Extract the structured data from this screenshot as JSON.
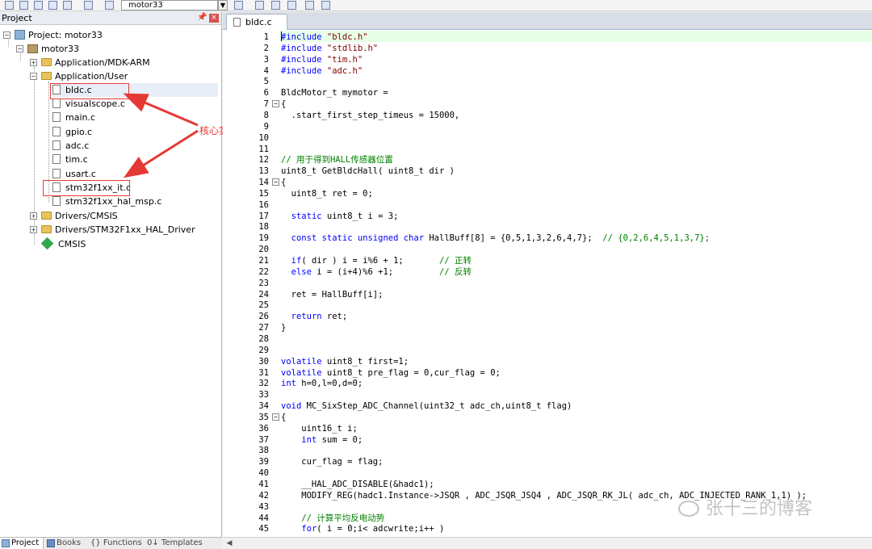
{
  "toolbar": {
    "target_name": "motor33"
  },
  "project_pane": {
    "title": "Project",
    "pin_glyph": "ᵖ",
    "close_glyph": "×",
    "tree": {
      "project_label": "Project: motor33",
      "target_label": "motor33",
      "groups": [
        {
          "label": "Application/MDK-ARM",
          "expanded": false
        },
        {
          "label": "Application/User",
          "expanded": true
        }
      ],
      "files": [
        "bldc.c",
        "visualscope.c",
        "main.c",
        "gpio.c",
        "adc.c",
        "tim.c",
        "usart.c",
        "stm32f1xx_it.c",
        "stm32f1xx_hal_msp.c"
      ],
      "lower_groups": [
        "Drivers/CMSIS",
        "Drivers/STM32F1xx_HAL_Driver"
      ],
      "cmsis_label": "CMSIS"
    },
    "tabs": [
      "Project",
      "Books",
      "{} Functions",
      "0↓ Templates"
    ]
  },
  "annotation": {
    "text": "核心实现在这两个文件中",
    "color": "#e53935"
  },
  "editor": {
    "tab_label": "bldc.c",
    "lines": [
      {
        "n": "1",
        "html": "<span class=\"kw\">#include</span> <span class=\"str\">\"bldc.h\"</span>"
      },
      {
        "n": "2",
        "html": "<span class=\"kw\">#include</span> <span class=\"str\">\"stdlib.h\"</span>"
      },
      {
        "n": "3",
        "html": "<span class=\"kw\">#include</span> <span class=\"str\">\"tim.h\"</span>"
      },
      {
        "n": "4",
        "html": "<span class=\"kw\">#include</span> <span class=\"str\">\"adc.h\"</span>"
      },
      {
        "n": "5",
        "html": ""
      },
      {
        "n": "6",
        "html": "BldcMotor_t mymotor ="
      },
      {
        "n": "7",
        "html": "{",
        "fold": true
      },
      {
        "n": "8",
        "html": "  .start_first_step_timeus = 15000,"
      },
      {
        "n": "9",
        "html": ""
      },
      {
        "n": "10",
        "html": ""
      },
      {
        "n": "11",
        "html": ""
      },
      {
        "n": "12",
        "html": "<span class=\"cmt\">// 用于得到HALL传感器位置</span>"
      },
      {
        "n": "13",
        "html": "uint8_t GetBldcHall( uint8_t dir )"
      },
      {
        "n": "14",
        "html": "{",
        "fold": true
      },
      {
        "n": "15",
        "html": "  uint8_t ret = 0;"
      },
      {
        "n": "16",
        "html": ""
      },
      {
        "n": "17",
        "html": "  <span class=\"kw\">static</span> uint8_t i = 3;"
      },
      {
        "n": "18",
        "html": ""
      },
      {
        "n": "19",
        "html": "  <span class=\"kw\">const static unsigned char</span> HallBuff[8] = {0,5,1,3,2,6,4,7};  <span class=\"cmt\">// {0,2,6,4,5,1,3,7};</span>"
      },
      {
        "n": "20",
        "html": ""
      },
      {
        "n": "21",
        "html": "  <span class=\"kw\">if</span>( dir ) i = i%6 + 1;       <span class=\"cmt\">// 正转</span>"
      },
      {
        "n": "22",
        "html": "  <span class=\"kw\">else</span> i = (i+4)%6 +1;         <span class=\"cmt\">// 反转</span>"
      },
      {
        "n": "23",
        "html": ""
      },
      {
        "n": "24",
        "html": "  ret = HallBuff[i];"
      },
      {
        "n": "25",
        "html": ""
      },
      {
        "n": "26",
        "html": "  <span class=\"kw\">return</span> ret;"
      },
      {
        "n": "27",
        "html": "}"
      },
      {
        "n": "28",
        "html": ""
      },
      {
        "n": "29",
        "html": ""
      },
      {
        "n": "30",
        "html": "<span class=\"kw\">volatile</span> uint8_t first=1;"
      },
      {
        "n": "31",
        "html": "<span class=\"kw\">volatile</span> uint8_t pre_flag = 0,cur_flag = 0;"
      },
      {
        "n": "32",
        "html": "<span class=\"kw\">int</span> h=0,l=0,d=0;"
      },
      {
        "n": "33",
        "html": ""
      },
      {
        "n": "34",
        "html": "<span class=\"kw\">void</span> MC_SixStep_ADC_Channel(uint32_t adc_ch,uint8_t flag)"
      },
      {
        "n": "35",
        "html": "{",
        "fold": true
      },
      {
        "n": "36",
        "html": "    uint16_t i;"
      },
      {
        "n": "37",
        "html": "    <span class=\"kw\">int</span> sum = 0;"
      },
      {
        "n": "38",
        "html": ""
      },
      {
        "n": "39",
        "html": "    cur_flag = flag;"
      },
      {
        "n": "40",
        "html": ""
      },
      {
        "n": "41",
        "html": "    __HAL_ADC_DISABLE(&amp;hadc1);"
      },
      {
        "n": "42",
        "html": "    MODIFY_REG(hadc1.Instance-&gt;JSQR , ADC_JSQR_JSQ4 , ADC_JSQR_RK_JL( adc_ch, ADC_INJECTED_RANK_1,1) );"
      },
      {
        "n": "43",
        "html": ""
      },
      {
        "n": "44",
        "html": "    <span class=\"cmt\">// 计算平均反电动势</span>"
      },
      {
        "n": "45",
        "html": "    <span class=\"kw\">for</span>( i = 0;i&lt; adcwrite;i++ )"
      }
    ]
  },
  "watermark": {
    "text": "张十三的博客"
  }
}
